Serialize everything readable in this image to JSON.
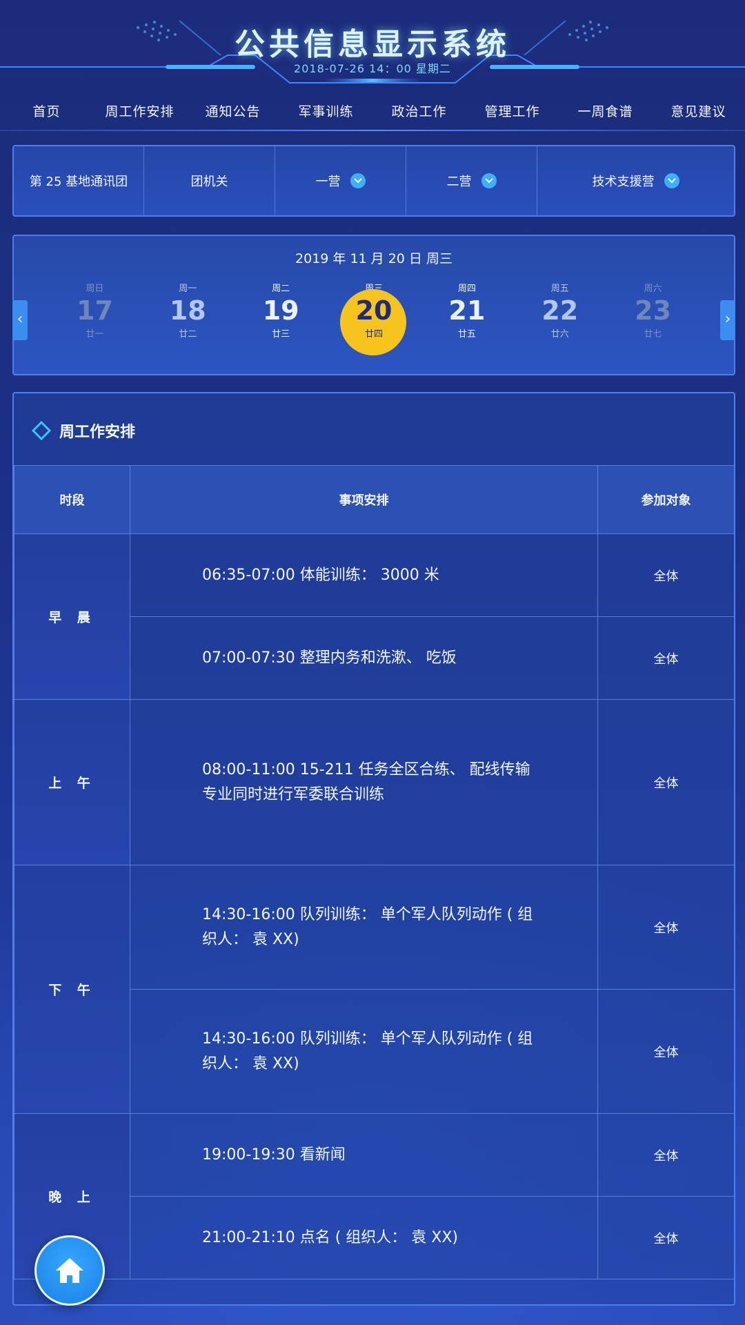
{
  "header": {
    "title": "公共信息显示系统",
    "datetime": "2018-07-26  14：00  星期二"
  },
  "nav": [
    {
      "label": "首页"
    },
    {
      "label": "周工作安排"
    },
    {
      "label": "通知公告"
    },
    {
      "label": "军事训练"
    },
    {
      "label": "政治工作"
    },
    {
      "label": "管理工作"
    },
    {
      "label": "一周食谱"
    },
    {
      "label": "意见建议"
    }
  ],
  "org": {
    "items": [
      {
        "label": "第 25 基地通讯团",
        "dropdown": false
      },
      {
        "label": "团机关",
        "dropdown": false
      },
      {
        "label": "一营",
        "dropdown": true
      },
      {
        "label": "二营",
        "dropdown": true
      },
      {
        "label": "技术支援营",
        "dropdown": true
      }
    ]
  },
  "calendar": {
    "date": "2019 年 11 月 20 日    周三",
    "days": [
      {
        "weekday": "周日",
        "day": "17",
        "lunar": "廿一",
        "state": "dim"
      },
      {
        "weekday": "周一",
        "day": "18",
        "lunar": "廿二",
        "state": "normal"
      },
      {
        "weekday": "周二",
        "day": "19",
        "lunar": "廿三",
        "state": "bright"
      },
      {
        "weekday": "周三",
        "day": "20",
        "lunar": "廿四",
        "state": "selected"
      },
      {
        "weekday": "周四",
        "day": "21",
        "lunar": "廿五",
        "state": "bright"
      },
      {
        "weekday": "周五",
        "day": "22",
        "lunar": "廿六",
        "state": "normal"
      },
      {
        "weekday": "周六",
        "day": "23",
        "lunar": "廿七",
        "state": "dim"
      }
    ],
    "prev_label": "‹",
    "next_label": "›"
  },
  "schedule": {
    "title": "周工作安排",
    "columns": [
      "时段",
      "事项安排",
      "参加对象"
    ],
    "periods": [
      {
        "name": "早 晨",
        "rows": [
          {
            "item": "06:35-07:00  体能训练：  3000 米",
            "who": "全体"
          },
          {
            "item": "07:00-07:30  整理内务和洗漱、  吃饭",
            "who": "全体"
          }
        ]
      },
      {
        "name": "上 午",
        "rows": [
          {
            "item": "08:00-11:00  15-211 任务全区合练、  配线传输专业同时进行军委联合训练",
            "who": "全体"
          }
        ]
      },
      {
        "name": "下 午",
        "rows": [
          {
            "item": "14:30-16:00  队列训练：  单个军人队列动作 ( 组织人：  袁 XX)",
            "who": "全体"
          },
          {
            "item": "14:30-16:00  队列训练：  单个军人队列动作 ( 组织人：  袁 XX)",
            "who": "全体"
          }
        ]
      },
      {
        "name": "晚 上",
        "rows": [
          {
            "item": "19:00-19:30  看新闻",
            "who": "全体"
          },
          {
            "item": "21:00-21:10  点名 ( 组织人：  袁 XX)",
            "who": "全体"
          }
        ]
      }
    ]
  },
  "colors": {
    "accent": "#3fb0ff",
    "selected_day": "#f7c31d",
    "border": "#4d7ff0"
  },
  "icons": {
    "home": "home-icon",
    "dropdown": "chevron-down-icon",
    "title_marker": "diamond-icon"
  }
}
